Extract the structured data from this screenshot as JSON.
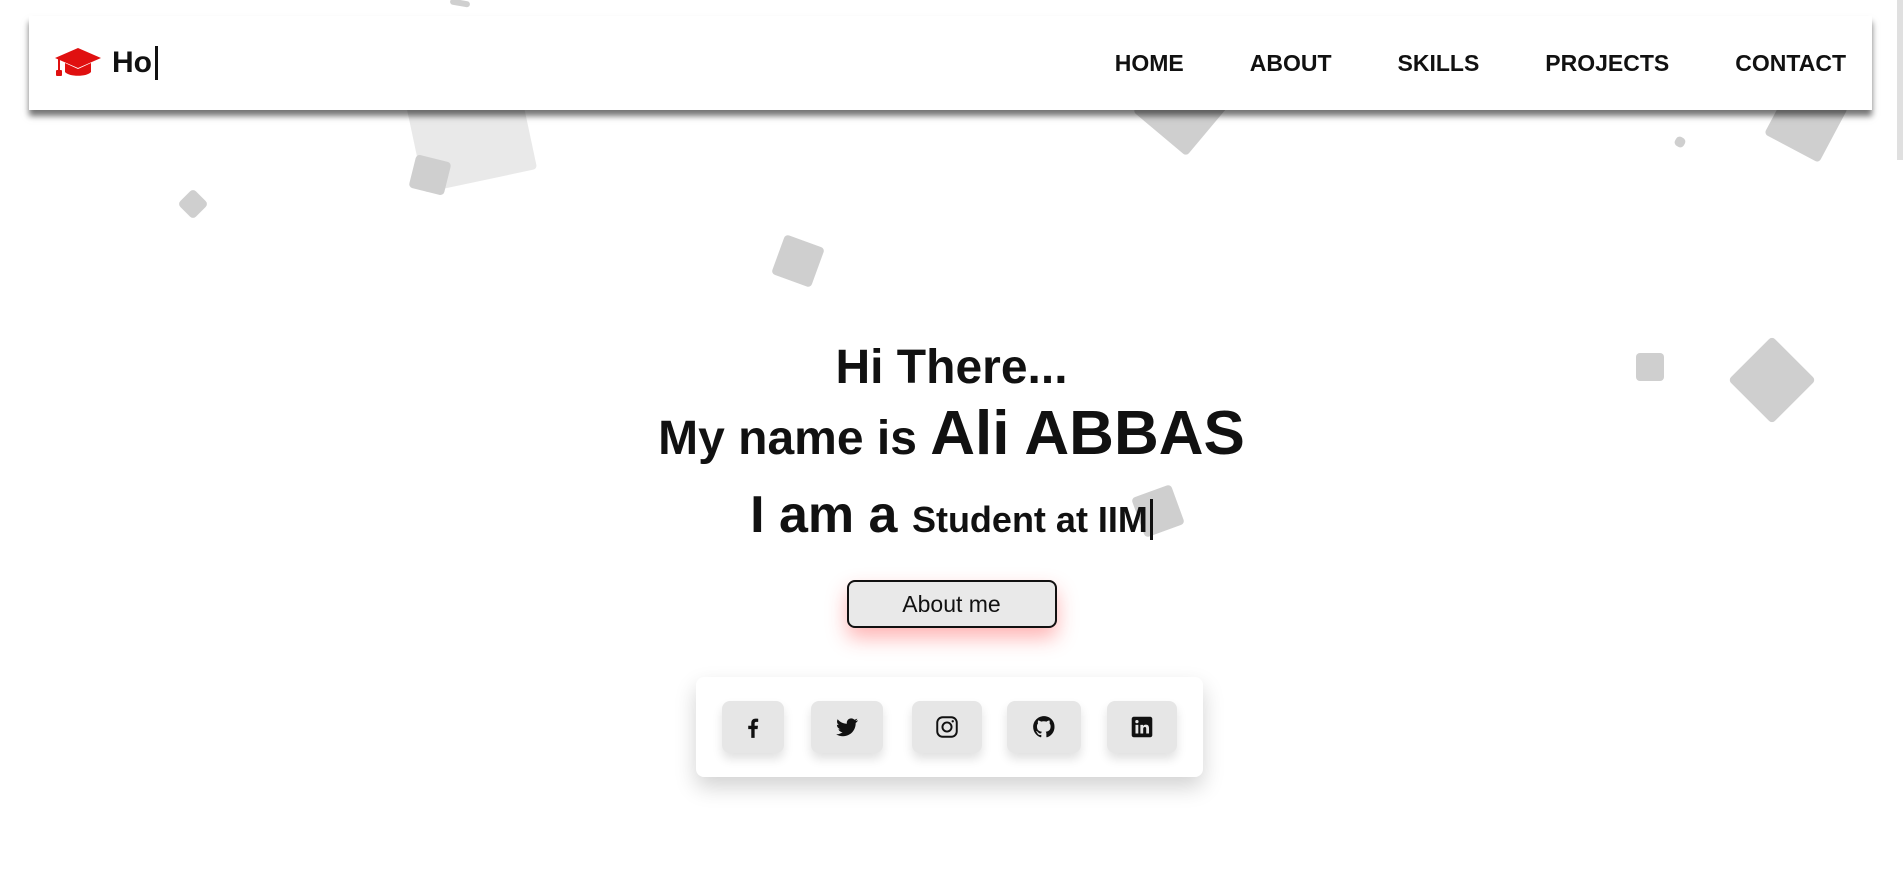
{
  "brand": {
    "icon": "graduation-cap-icon",
    "text": "Ho",
    "icon_color": "#e01010"
  },
  "nav": {
    "items": [
      "HOME",
      "ABOUT",
      "SKILLS",
      "PROJECTS",
      "CONTACT"
    ]
  },
  "hero": {
    "greeting": "Hi There...",
    "name_prefix": "My name is",
    "name": "Ali ABBAS",
    "role_prefix": "I am a",
    "role_typed": "Student at IIM",
    "about_button": "About me"
  },
  "social": {
    "icons": [
      "facebook-icon",
      "twitter-icon",
      "instagram-icon",
      "github-icon",
      "linkedin-icon"
    ]
  }
}
